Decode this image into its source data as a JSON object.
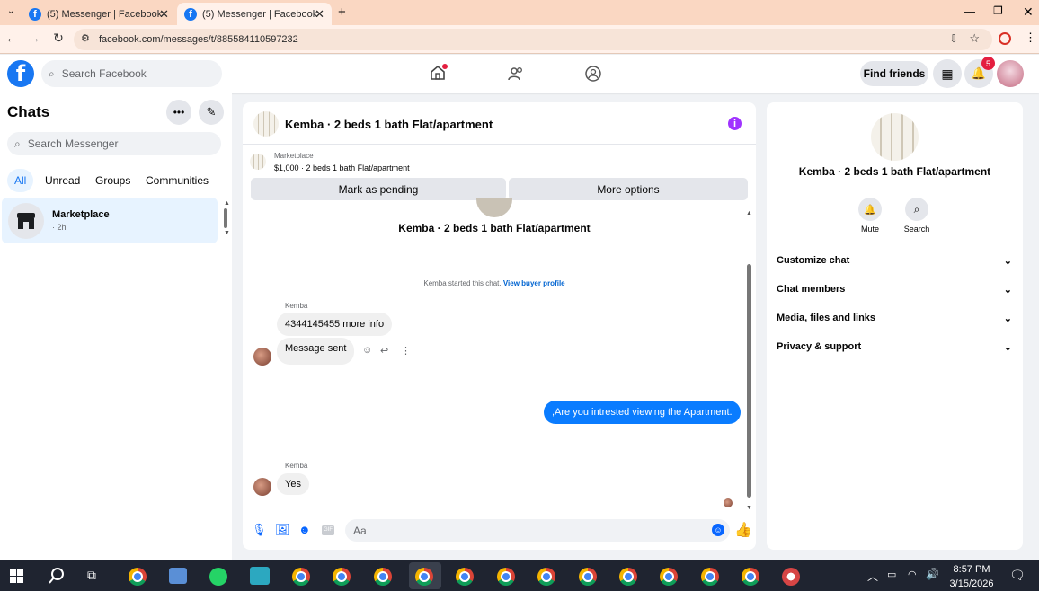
{
  "browser": {
    "tabs": [
      {
        "title": "(5) Messenger | Facebook"
      },
      {
        "title": "(5) Messenger | Facebook"
      }
    ],
    "url": "facebook.com/messages/t/885584110597232"
  },
  "fb": {
    "search_placeholder": "Search Facebook",
    "find_friends": "Find friends",
    "notif_count": "5"
  },
  "chats": {
    "title": "Chats",
    "search_placeholder": "Search Messenger",
    "filters": [
      "All",
      "Unread",
      "Groups",
      "Communities"
    ],
    "items": [
      {
        "name": "Marketplace",
        "meta": "· 2h"
      }
    ]
  },
  "conversation": {
    "title": "Kemba · 2 beds 1 bath Flat/apartment",
    "listing_label": "Marketplace",
    "listing_detail": "$1,000 · 2 beds 1 bath Flat/apartment",
    "mark_pending": "Mark as pending",
    "more_options": "More options",
    "intro_title": "Kemba · 2 beds 1 bath Flat/apartment",
    "started_text": "Kemba started this chat.",
    "view_profile": "View buyer profile",
    "messages": [
      {
        "sender": "Kemba",
        "text": "4344145455 more info"
      },
      {
        "sender": "",
        "text": "Message sent"
      },
      {
        "sender": "me",
        "text": ",Are you intrested viewing the Apartment."
      },
      {
        "sender": "Kemba",
        "text": "Yes"
      }
    ],
    "composer_placeholder": "Aa"
  },
  "details": {
    "title": "Kemba · 2 beds 1 bath Flat/apartment",
    "mute": "Mute",
    "search": "Search",
    "sections": [
      "Customize chat",
      "Chat members",
      "Media, files and links",
      "Privacy & support"
    ]
  },
  "taskbar": {
    "time": "8:57 PM",
    "date": "3/15/2026"
  },
  "colors": {
    "accent": "#1877f2",
    "messenger_purple": "#a033ff",
    "tabbar": "#fad7c2"
  }
}
